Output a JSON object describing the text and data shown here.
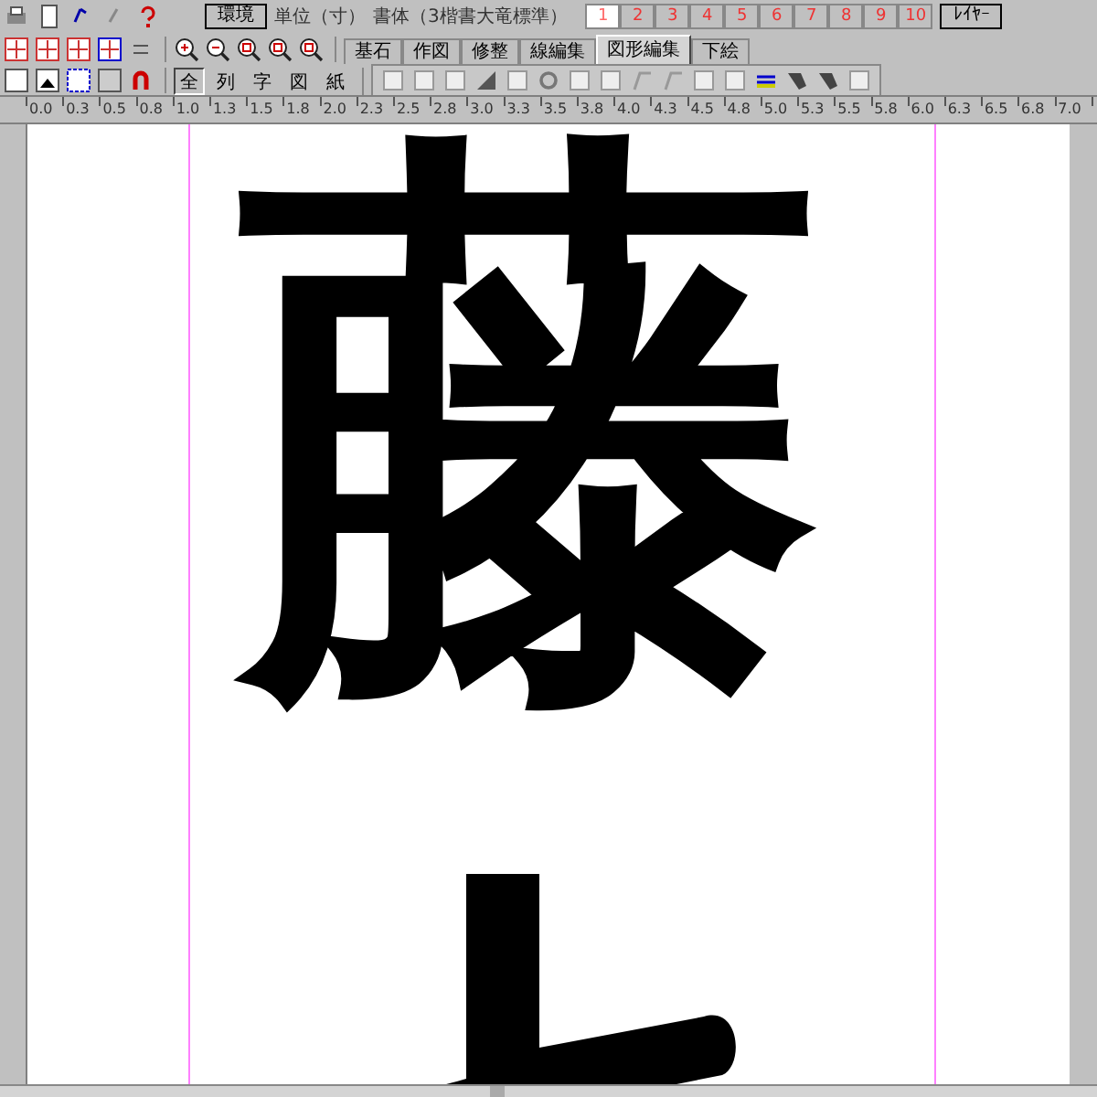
{
  "toolbar": {
    "env_button": "環境",
    "unit": "単位（寸）",
    "typeface": "書体（3楷書大竜標準）",
    "pages": [
      {
        "label": "1",
        "selected": true
      },
      {
        "label": "2",
        "selected": false
      },
      {
        "label": "3",
        "selected": false
      },
      {
        "label": "4",
        "selected": false
      },
      {
        "label": "5",
        "selected": false
      },
      {
        "label": "6",
        "selected": false
      },
      {
        "label": "7",
        "selected": false
      },
      {
        "label": "8",
        "selected": false
      },
      {
        "label": "9",
        "selected": false
      },
      {
        "label": "10",
        "selected": false
      }
    ],
    "layer_button": "ﾚｲﾔｰ",
    "view_buttons": [
      {
        "label": "全",
        "selected": true
      },
      {
        "label": "列",
        "selected": false
      },
      {
        "label": "字",
        "selected": false
      },
      {
        "label": "図",
        "selected": false
      },
      {
        "label": "紙",
        "selected": false
      }
    ],
    "tabs": [
      {
        "label": "基石",
        "selected": false
      },
      {
        "label": "作図",
        "selected": false
      },
      {
        "label": "修整",
        "selected": false
      },
      {
        "label": "線編集",
        "selected": false
      },
      {
        "label": "図形編集",
        "selected": true
      },
      {
        "label": "下絵",
        "selected": false
      }
    ]
  },
  "ruler": [
    "0.0",
    "0.3",
    "0.5",
    "0.8",
    "1.0",
    "1.3",
    "1.5",
    "1.8",
    "2.0",
    "2.3",
    "2.5",
    "2.8",
    "3.0",
    "3.3",
    "3.5",
    "3.8",
    "4.0",
    "4.3",
    "4.5",
    "4.8",
    "5.0",
    "5.3",
    "5.5",
    "5.8",
    "6.0",
    "6.3",
    "6.5",
    "6.8",
    "7.0"
  ],
  "canvas": {
    "character": "藤"
  }
}
